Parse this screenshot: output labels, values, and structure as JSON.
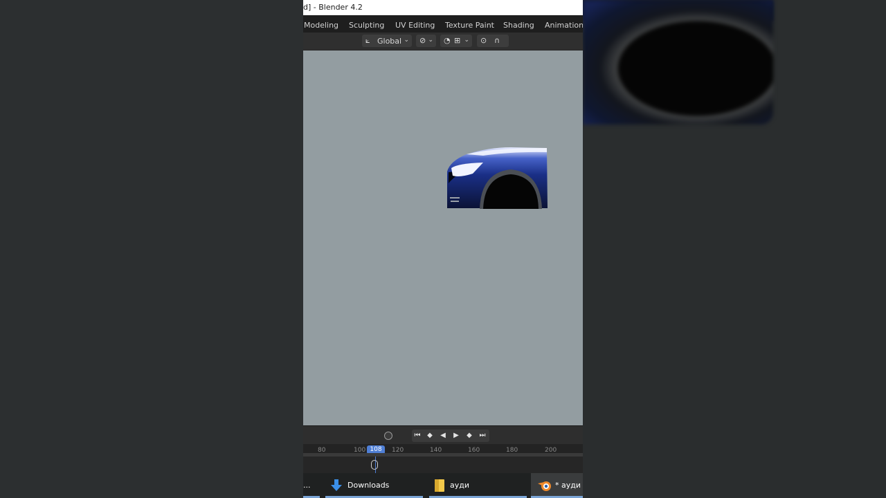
{
  "window": {
    "title": "d] - Blender 4.2"
  },
  "workspace_tabs": [
    "Modeling",
    "Sculpting",
    "UV Editing",
    "Texture Paint",
    "Shading",
    "Animation"
  ],
  "header": {
    "orientation_label": "Global"
  },
  "timeline": {
    "ticks": [
      "80",
      "100",
      "120",
      "140",
      "160",
      "180",
      "200"
    ],
    "current_frame": "108"
  },
  "taskbar": {
    "items": [
      {
        "label": "...",
        "icon": "app-icon"
      },
      {
        "label": "Downloads",
        "icon": "download-arrow-icon"
      },
      {
        "label": "ауди",
        "icon": "folder-icon"
      },
      {
        "label": "* ауди [(",
        "icon": "blender-icon"
      }
    ]
  },
  "colors": {
    "viewport_bg": "#939da1",
    "car_paint": "#1e3a9a",
    "accent_blue": "#4f7fd6"
  }
}
